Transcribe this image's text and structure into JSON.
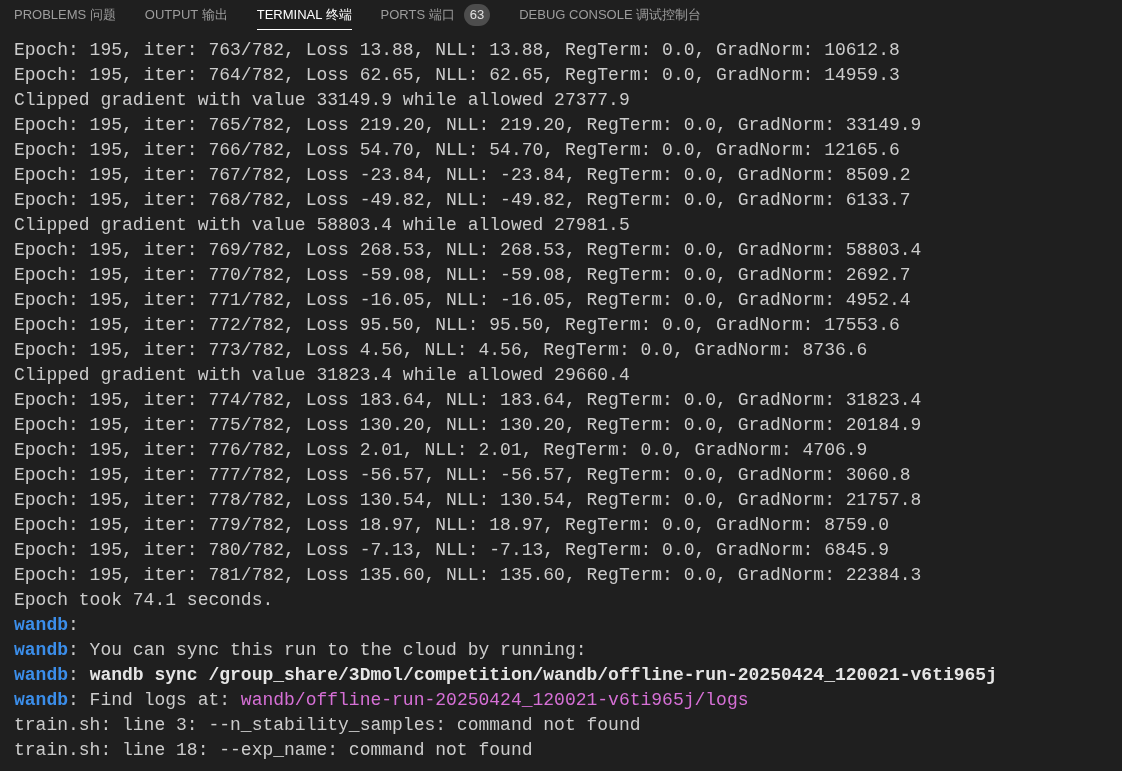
{
  "tabs": [
    {
      "label": "PROBLEMS",
      "label_cn": "问题",
      "selected": false
    },
    {
      "label": "OUTPUT",
      "label_cn": "输出",
      "selected": false
    },
    {
      "label": "TERMINAL",
      "label_cn": "终端",
      "selected": true
    },
    {
      "label": "PORTS",
      "label_cn": "端口",
      "selected": false,
      "badge": "63"
    },
    {
      "label": "DEBUG CONSOLE",
      "label_cn": "调试控制台",
      "selected": false
    }
  ],
  "terminal": {
    "lines": [
      {
        "segments": [
          {
            "kind": "plain",
            "text": "Epoch: 195, iter: 763/782, Loss 13.88, NLL: 13.88, RegTerm: 0.0, GradNorm: 10612.8"
          }
        ]
      },
      {
        "segments": [
          {
            "kind": "plain",
            "text": "Epoch: 195, iter: 764/782, Loss 62.65, NLL: 62.65, RegTerm: 0.0, GradNorm: 14959.3"
          }
        ]
      },
      {
        "segments": [
          {
            "kind": "plain",
            "text": "Clipped gradient with value 33149.9 while allowed 27377.9"
          }
        ]
      },
      {
        "segments": [
          {
            "kind": "plain",
            "text": "Epoch: 195, iter: 765/782, Loss 219.20, NLL: 219.20, RegTerm: 0.0, GradNorm: 33149.9"
          }
        ]
      },
      {
        "segments": [
          {
            "kind": "plain",
            "text": "Epoch: 195, iter: 766/782, Loss 54.70, NLL: 54.70, RegTerm: 0.0, GradNorm: 12165.6"
          }
        ]
      },
      {
        "segments": [
          {
            "kind": "plain",
            "text": "Epoch: 195, iter: 767/782, Loss -23.84, NLL: -23.84, RegTerm: 0.0, GradNorm: 8509.2"
          }
        ]
      },
      {
        "segments": [
          {
            "kind": "plain",
            "text": "Epoch: 195, iter: 768/782, Loss -49.82, NLL: -49.82, RegTerm: 0.0, GradNorm: 6133.7"
          }
        ]
      },
      {
        "segments": [
          {
            "kind": "plain",
            "text": "Clipped gradient with value 58803.4 while allowed 27981.5"
          }
        ]
      },
      {
        "segments": [
          {
            "kind": "plain",
            "text": "Epoch: 195, iter: 769/782, Loss 268.53, NLL: 268.53, RegTerm: 0.0, GradNorm: 58803.4"
          }
        ]
      },
      {
        "segments": [
          {
            "kind": "plain",
            "text": "Epoch: 195, iter: 770/782, Loss -59.08, NLL: -59.08, RegTerm: 0.0, GradNorm: 2692.7"
          }
        ]
      },
      {
        "segments": [
          {
            "kind": "plain",
            "text": "Epoch: 195, iter: 771/782, Loss -16.05, NLL: -16.05, RegTerm: 0.0, GradNorm: 4952.4"
          }
        ]
      },
      {
        "segments": [
          {
            "kind": "plain",
            "text": "Epoch: 195, iter: 772/782, Loss 95.50, NLL: 95.50, RegTerm: 0.0, GradNorm: 17553.6"
          }
        ]
      },
      {
        "segments": [
          {
            "kind": "plain",
            "text": "Epoch: 195, iter: 773/782, Loss 4.56, NLL: 4.56, RegTerm: 0.0, GradNorm: 8736.6"
          }
        ]
      },
      {
        "segments": [
          {
            "kind": "plain",
            "text": "Clipped gradient with value 31823.4 while allowed 29660.4"
          }
        ]
      },
      {
        "segments": [
          {
            "kind": "plain",
            "text": "Epoch: 195, iter: 774/782, Loss 183.64, NLL: 183.64, RegTerm: 0.0, GradNorm: 31823.4"
          }
        ]
      },
      {
        "segments": [
          {
            "kind": "plain",
            "text": "Epoch: 195, iter: 775/782, Loss 130.20, NLL: 130.20, RegTerm: 0.0, GradNorm: 20184.9"
          }
        ]
      },
      {
        "segments": [
          {
            "kind": "plain",
            "text": "Epoch: 195, iter: 776/782, Loss 2.01, NLL: 2.01, RegTerm: 0.0, GradNorm: 4706.9"
          }
        ]
      },
      {
        "segments": [
          {
            "kind": "plain",
            "text": "Epoch: 195, iter: 777/782, Loss -56.57, NLL: -56.57, RegTerm: 0.0, GradNorm: 3060.8"
          }
        ]
      },
      {
        "segments": [
          {
            "kind": "plain",
            "text": "Epoch: 195, iter: 778/782, Loss 130.54, NLL: 130.54, RegTerm: 0.0, GradNorm: 21757.8"
          }
        ]
      },
      {
        "segments": [
          {
            "kind": "plain",
            "text": "Epoch: 195, iter: 779/782, Loss 18.97, NLL: 18.97, RegTerm: 0.0, GradNorm: 8759.0"
          }
        ]
      },
      {
        "segments": [
          {
            "kind": "plain",
            "text": "Epoch: 195, iter: 780/782, Loss -7.13, NLL: -7.13, RegTerm: 0.0, GradNorm: 6845.9"
          }
        ]
      },
      {
        "segments": [
          {
            "kind": "plain",
            "text": "Epoch: 195, iter: 781/782, Loss 135.60, NLL: 135.60, RegTerm: 0.0, GradNorm: 22384.3"
          }
        ]
      },
      {
        "segments": [
          {
            "kind": "plain",
            "text": "Epoch took 74.1 seconds."
          }
        ]
      },
      {
        "segments": [
          {
            "kind": "prefix",
            "text": "wandb"
          },
          {
            "kind": "plain",
            "text": ":"
          }
        ]
      },
      {
        "segments": [
          {
            "kind": "prefix",
            "text": "wandb"
          },
          {
            "kind": "plain",
            "text": ": You can sync this run to the cloud by running:"
          }
        ]
      },
      {
        "segments": [
          {
            "kind": "prefix",
            "text": "wandb"
          },
          {
            "kind": "plain",
            "text": ": "
          },
          {
            "kind": "bold",
            "text": "wandb sync /group_share/3Dmol/competition/wandb/offline-run-20250424_120021-v6ti965j"
          }
        ]
      },
      {
        "segments": [
          {
            "kind": "prefix",
            "text": "wandb"
          },
          {
            "kind": "plain",
            "text": ": Find logs at: "
          },
          {
            "kind": "path",
            "text": "wandb/offline-run-20250424_120021-v6ti965j/logs"
          }
        ]
      },
      {
        "segments": [
          {
            "kind": "plain",
            "text": "train.sh: line 3: --n_stability_samples: command not found"
          }
        ]
      },
      {
        "segments": [
          {
            "kind": "plain",
            "text": "train.sh: line 18: --exp_name: command not found"
          }
        ]
      }
    ]
  }
}
